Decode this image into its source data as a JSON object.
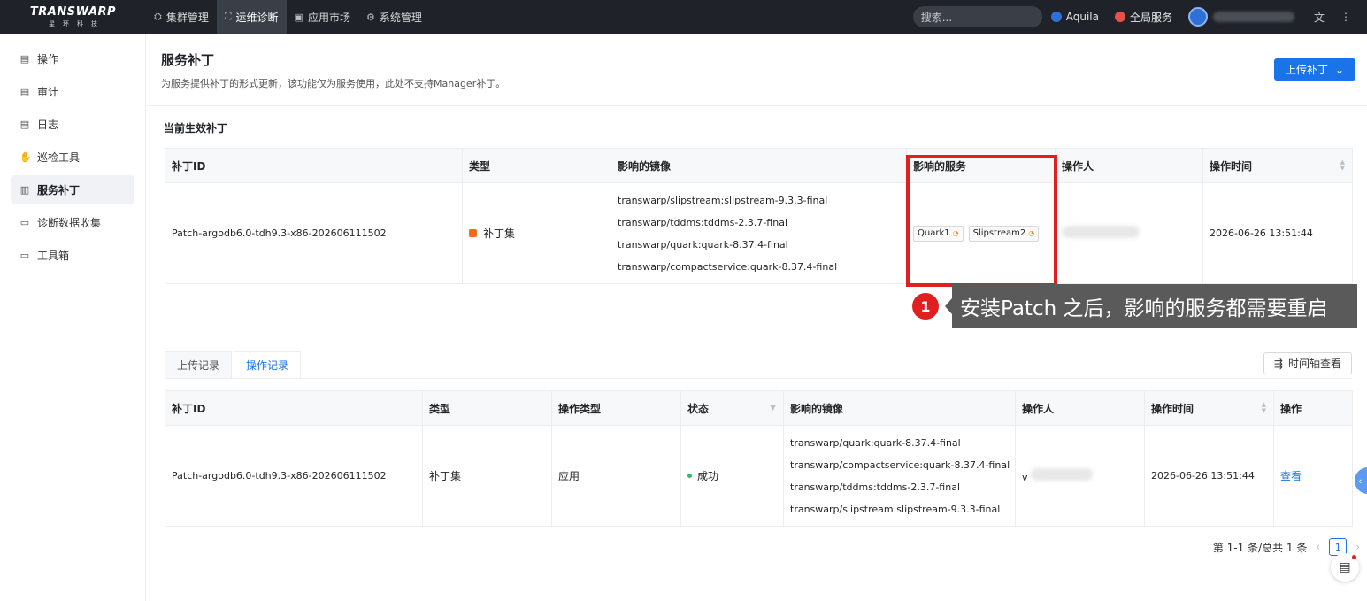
{
  "topbar": {
    "logo": "TRANSWARP",
    "logo_sub": "星环科技",
    "nav": [
      {
        "label": "集群管理",
        "icon": "cluster-icon"
      },
      {
        "label": "运维诊断",
        "icon": "diagnose-icon"
      },
      {
        "label": "应用市场",
        "icon": "market-icon"
      },
      {
        "label": "系统管理",
        "icon": "gear-icon"
      }
    ],
    "search_placeholder": "搜索...",
    "links": [
      {
        "label": "Aquila",
        "color": "#2f6fd8"
      },
      {
        "label": "全局服务",
        "color": "#e8504a"
      }
    ]
  },
  "sidebar": {
    "items": [
      {
        "label": "操作",
        "icon": "operation-icon"
      },
      {
        "label": "审计",
        "icon": "audit-icon"
      },
      {
        "label": "日志",
        "icon": "log-icon"
      },
      {
        "label": "巡检工具",
        "icon": "inspect-icon"
      },
      {
        "label": "服务补丁",
        "icon": "patch-icon"
      },
      {
        "label": "诊断数据收集",
        "icon": "collect-icon"
      },
      {
        "label": "工具箱",
        "icon": "toolbox-icon"
      }
    ]
  },
  "header": {
    "title": "服务补丁",
    "description": "为服务提供补丁的形式更新，该功能仅为服务使用，此处不支持Manager补丁。",
    "upload_button": "上传补丁"
  },
  "current": {
    "section_title": "当前生效补丁",
    "columns": [
      "补丁ID",
      "类型",
      "影响的镜像",
      "影响的服务",
      "操作人",
      "操作时间"
    ],
    "row": {
      "id": "Patch-argodb6.0-tdh9.3-x86-202606111502",
      "type": "补丁集",
      "images": [
        "transwarp/slipstream:slipstream-9.3.3-final",
        "transwarp/tddms:tddms-2.3.7-final",
        "transwarp/quark:quark-8.37.4-final",
        "transwarp/compactservice:quark-8.37.4-final"
      ],
      "services": [
        "Quark1",
        "Slipstream2"
      ],
      "time": "2026-06-26 13:51:44"
    }
  },
  "callout": {
    "number": "1",
    "text": "安装Patch 之后，影响的服务都需要重启"
  },
  "records": {
    "tabs": [
      "上传记录",
      "操作记录"
    ],
    "timeline_button": "时间轴查看",
    "columns": [
      "补丁ID",
      "类型",
      "操作类型",
      "状态",
      "影响的镜像",
      "操作人",
      "操作时间",
      "操作"
    ],
    "row": {
      "id": "Patch-argodb6.0-tdh9.3-x86-202606111502",
      "type": "补丁集",
      "op_type": "应用",
      "status": "成功",
      "images": [
        "transwarp/quark:quark-8.37.4-final",
        "transwarp/compactservice:quark-8.37.4-final",
        "transwarp/tddms:tddms-2.3.7-final",
        "transwarp/slipstream:slipstream-9.3.3-final"
      ],
      "operator_prefix": "v",
      "time": "2026-06-26 13:51:44",
      "action": "查看"
    }
  },
  "pagination": {
    "summary": "第 1-1 条/总共 1 条",
    "current_page": "1"
  }
}
